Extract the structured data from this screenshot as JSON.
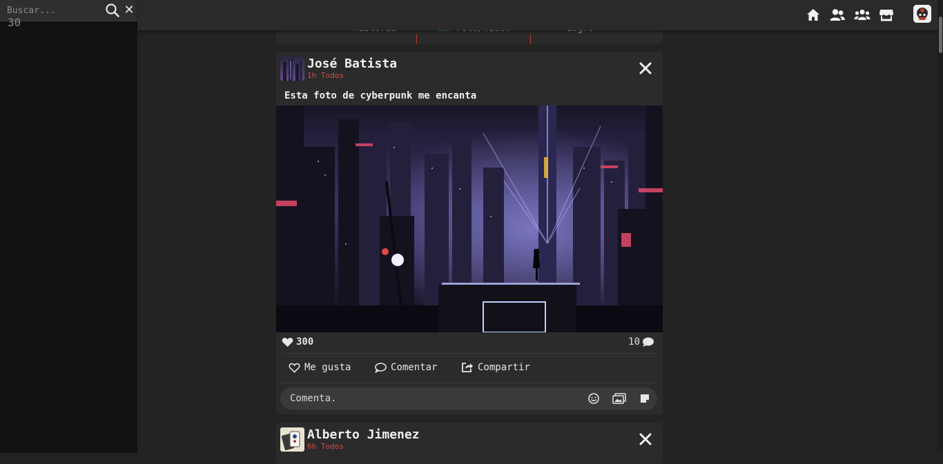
{
  "search": {
    "placeholder": "Buscar...",
    "value": ""
  },
  "sidebar": {
    "counter": "30"
  },
  "composer": {
    "options": [
      "Historia",
      "Foto/Video",
      "Logro"
    ]
  },
  "posts": [
    {
      "author": "José Batista",
      "time": "1h",
      "audience": "Todos",
      "text": "Esta foto de cyberpunk me encanta",
      "likes": "300",
      "comments": "10",
      "actions": {
        "like": "Me gusta",
        "comment": "Comentar",
        "share": "Compartir"
      },
      "comment_placeholder": "Comenta."
    },
    {
      "author": "Alberto Jimenez",
      "time": "6h",
      "audience": "Todos"
    }
  ],
  "colors": {
    "accent": "#d14b4b",
    "bg": "#232323",
    "card": "#2b2b2b",
    "sidebar": "#121212"
  },
  "icons": [
    "search-icon",
    "close-icon",
    "home-icon",
    "friends-icon",
    "groups-icon",
    "store-icon",
    "heart-icon",
    "comment-icon",
    "share-icon",
    "emoji-icon",
    "image-icon",
    "sticker-icon"
  ]
}
